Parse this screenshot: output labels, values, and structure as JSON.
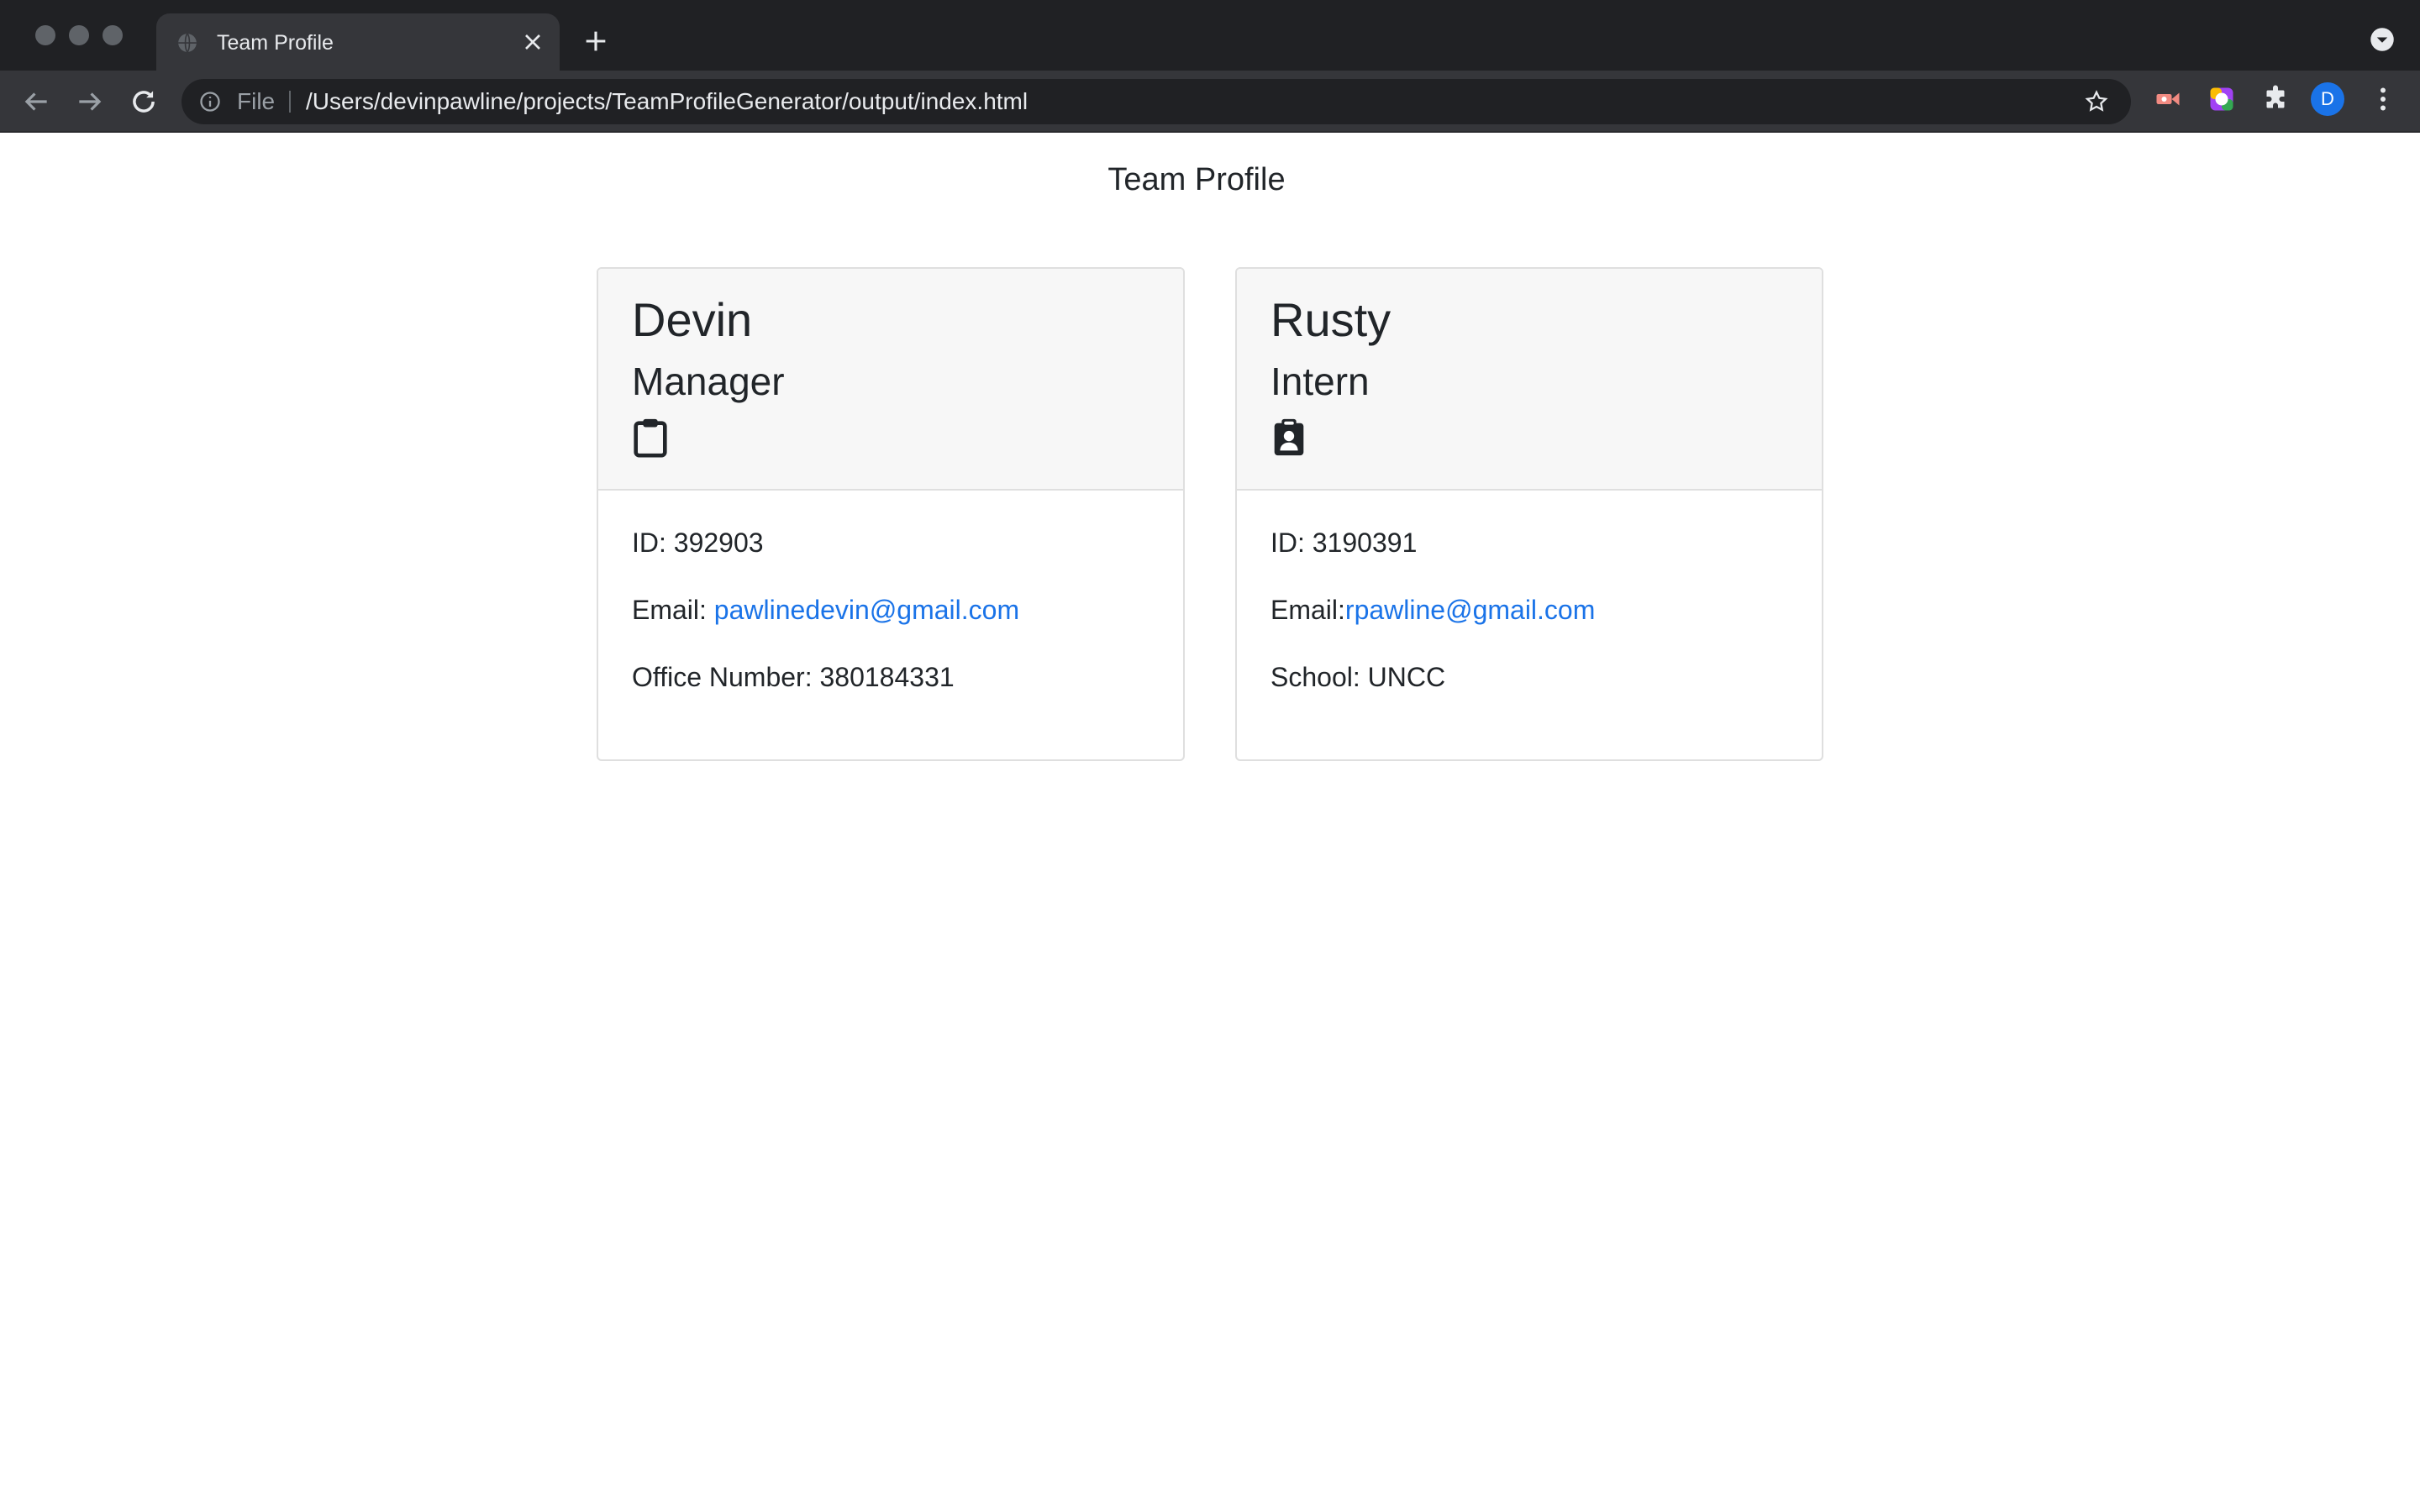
{
  "browser": {
    "tab_title": "Team Profile",
    "address_scheme": "File",
    "address_url": "/Users/devinpawline/projects/TeamProfileGenerator/output/index.html",
    "profile_initial": "D"
  },
  "page": {
    "title": "Team Profile"
  },
  "cards": [
    {
      "name": "Devin",
      "role": "Manager",
      "icon": "clipboard-icon",
      "id_text": "ID: 392903",
      "email_label": "Email: ",
      "email": "pawlinedevin@gmail.com",
      "extra_text": "Office Number: 380184331"
    },
    {
      "name": "Rusty",
      "role": "Intern",
      "icon": "user-badge-icon",
      "id_text": "ID: 3190391",
      "email_label": "Email:",
      "email": "rpawline@gmail.com",
      "extra_text": "School: UNCC"
    }
  ],
  "colors": {
    "link": "#1a73e8",
    "card_header_bg": "#f7f7f7",
    "browser_chrome": "#35363a"
  }
}
